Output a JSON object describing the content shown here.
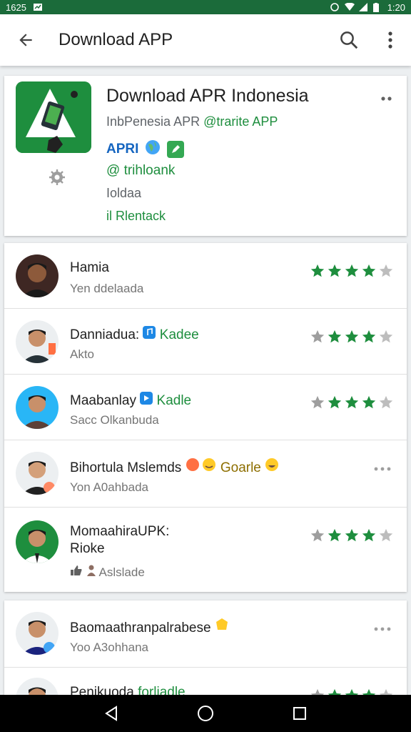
{
  "status": {
    "time_left": "1625",
    "time_right": "1:20"
  },
  "appbar": {
    "title": "Download APP",
    "back_icon": "arrow-back-icon",
    "search_icon": "search-icon",
    "more_icon": "more-vert-icon"
  },
  "app": {
    "title": "Download APR Indonesia",
    "subtitle": "InbPenesia APR",
    "subtitle_tag": "@trarite APP",
    "badge_text": "APRI",
    "handle": "@ trihloank",
    "location": "Ioldaa",
    "remark": "il Rlentack"
  },
  "reviews": [
    {
      "name": "Hamia",
      "tag": "",
      "meta": "Yen ddelaada",
      "rating": 3.5,
      "trailing": "stars"
    },
    {
      "name": "Danniadua:",
      "tag": "Kadee",
      "meta": "Akto",
      "rating": 3.5,
      "trailing": "stars"
    },
    {
      "name": "Maabanlay",
      "tag": "Kadle",
      "meta": "Sacc Olkanbuda",
      "rating": 3.5,
      "trailing": "stars"
    },
    {
      "name": "Bihortula Mslemds",
      "tag": "Goarle",
      "meta": "Yon A0ahbada",
      "rating": 0,
      "trailing": "dots"
    },
    {
      "name": "MomaahiraUPK:",
      "name2": "Rioke",
      "tag": "",
      "meta": "Aslslade",
      "rating": 3.5,
      "trailing": "stars"
    }
  ],
  "reviews2": [
    {
      "name": "Baomaathranpalrabese",
      "meta": "Yoo A3ohhana",
      "trailing": "dots"
    },
    {
      "name": "Penikuoda",
      "tag": "forliadle",
      "meta": "",
      "trailing": "stars"
    }
  ],
  "colors": {
    "status_bar": "#1b6b3a",
    "brand_green": "#1e8e3e",
    "star_green": "#1e8e3e",
    "star_grey": "#9e9e9e",
    "link_blue": "#1565c0"
  }
}
